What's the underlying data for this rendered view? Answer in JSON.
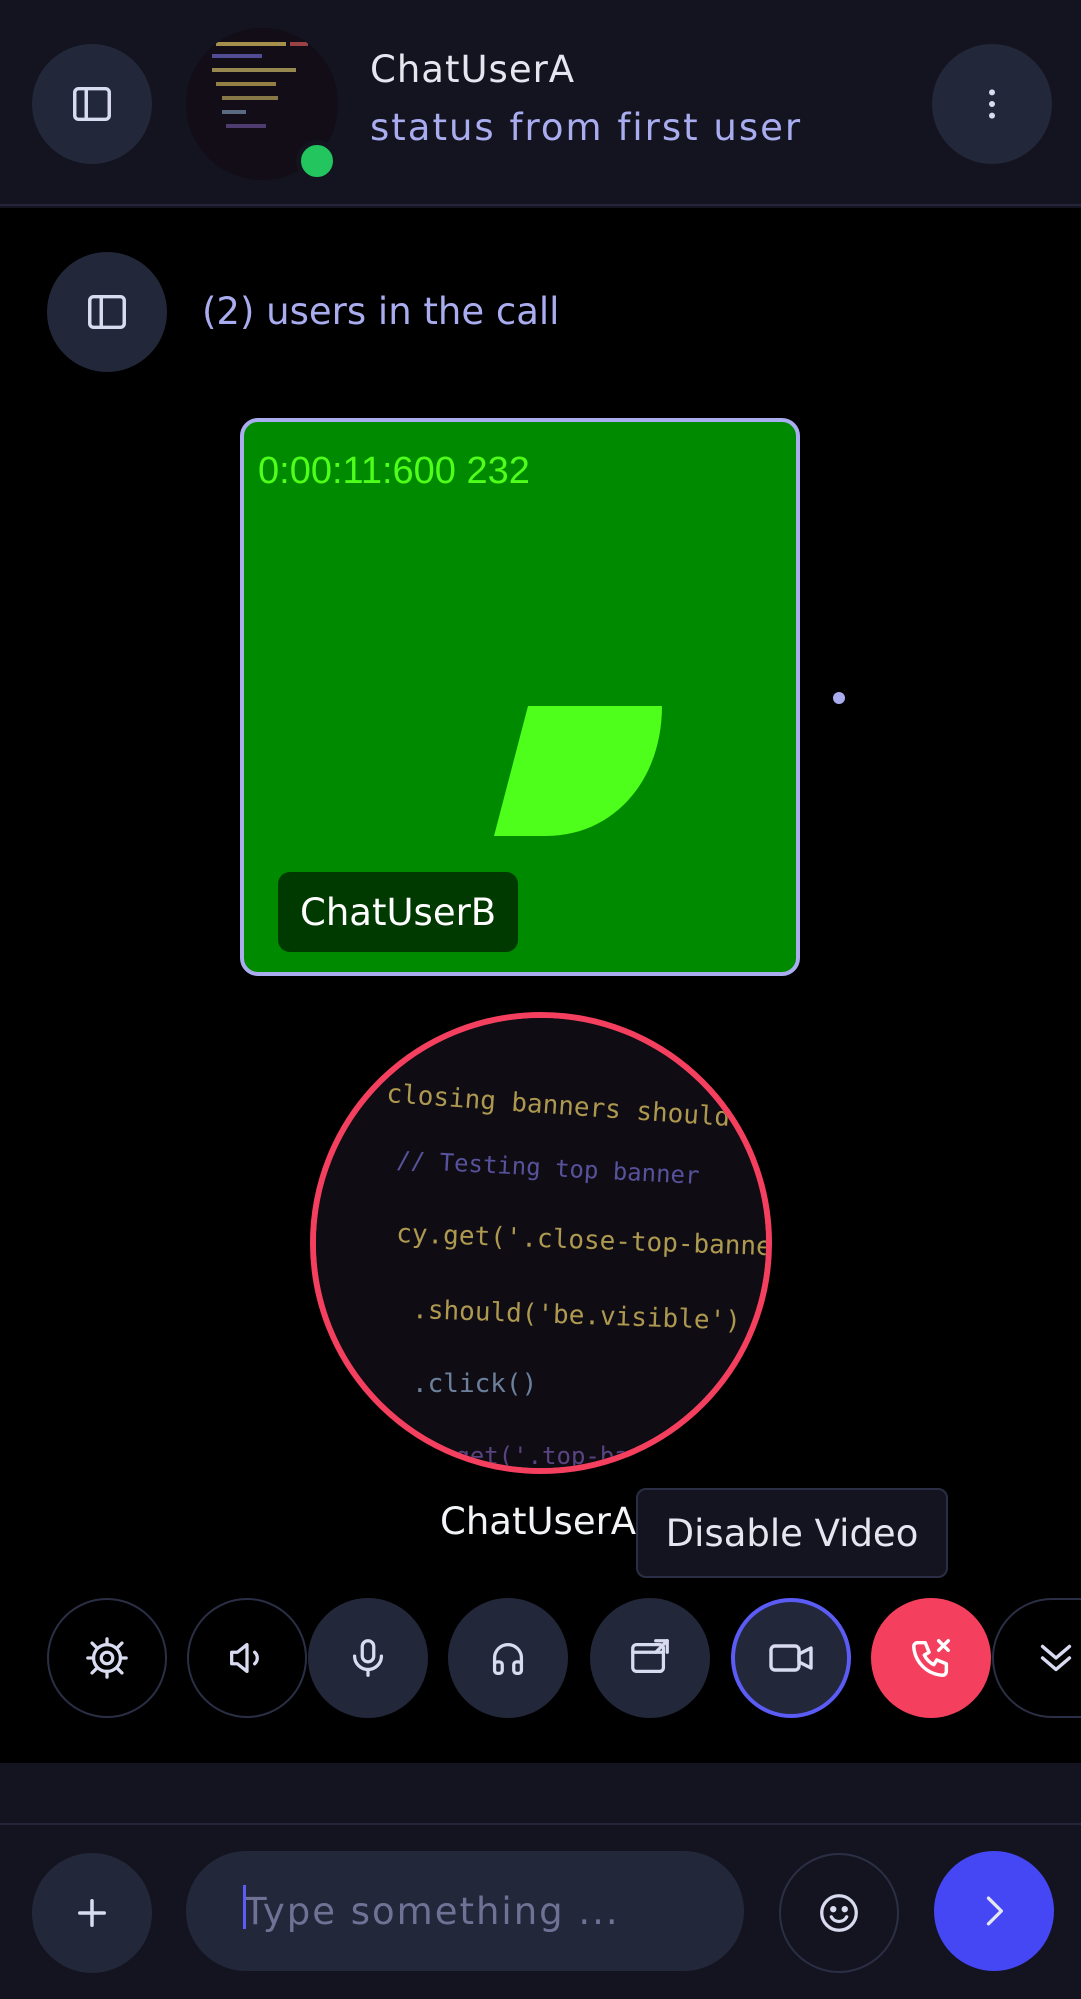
{
  "header": {
    "sidebar_icon": "sidebar-toggle-icon",
    "user_name": "ChatUserA",
    "user_status": "status from first user",
    "more_icon": "more-vertical-icon",
    "online_color": "#22c55e"
  },
  "call": {
    "participants_text": "(2) users in the call",
    "remote": {
      "timer": "0:00:11:600 232",
      "name": "ChatUserB",
      "tile_color": "#008a00"
    },
    "local": {
      "name": "ChatUserA",
      "ring_color": "#f43f5e"
    },
    "tooltip": "Disable Video",
    "controls": [
      {
        "name": "settings",
        "icon": "settings-icon"
      },
      {
        "name": "speaker",
        "icon": "speaker-icon"
      },
      {
        "name": "microphone",
        "icon": "microphone-icon"
      },
      {
        "name": "headphones",
        "icon": "headphones-icon"
      },
      {
        "name": "screen-share",
        "icon": "screen-share-icon"
      },
      {
        "name": "video",
        "icon": "video-camera-icon"
      },
      {
        "name": "hang-up",
        "icon": "phone-hangup-icon"
      },
      {
        "name": "collapse",
        "icon": "chevron-down-icon"
      }
    ]
  },
  "composer": {
    "placeholder": "Type something ...",
    "add_icon": "plus-icon",
    "emoji_icon": "emoji-icon",
    "send_icon": "send-chevron-icon",
    "accent": "#4547f5"
  }
}
